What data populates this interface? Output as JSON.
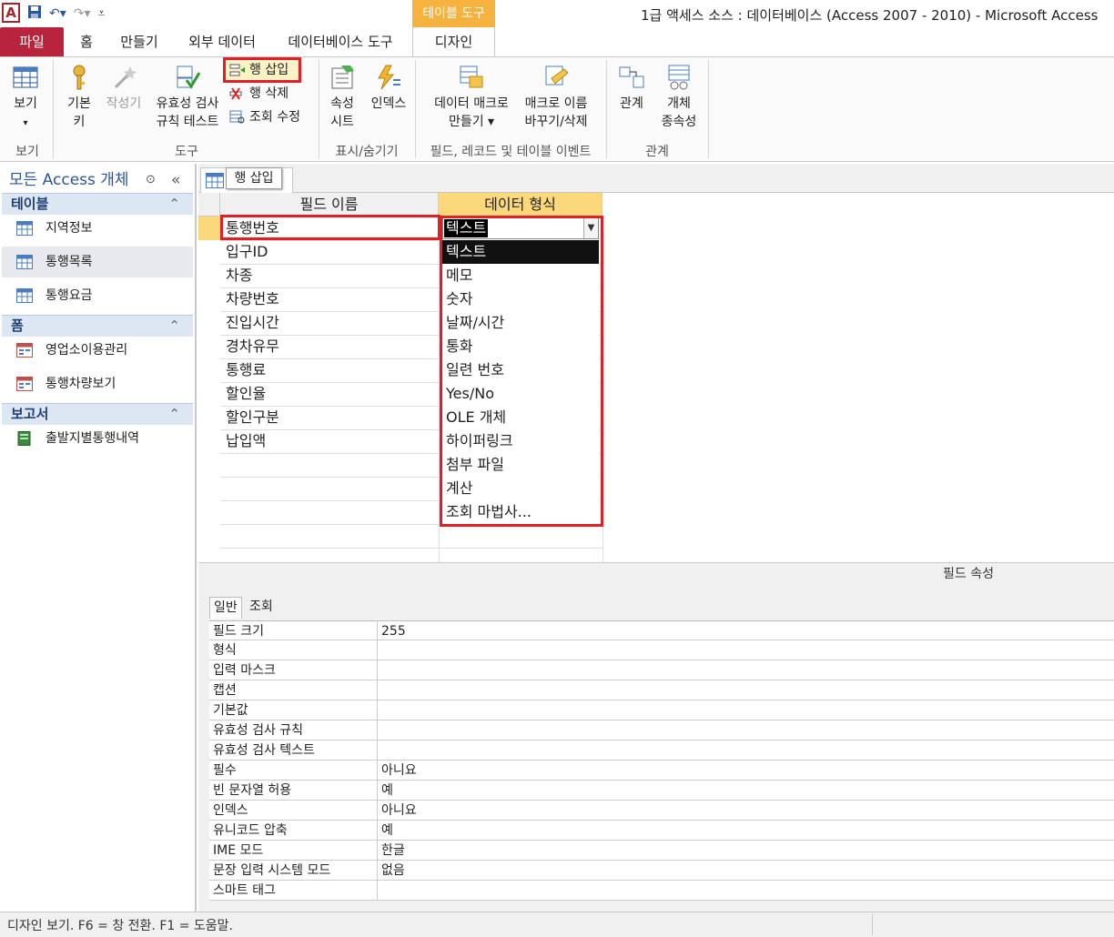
{
  "title": "1급 액세스 소스 : 데이터베이스 (Access 2007 - 2010)  -  Microsoft Access",
  "app_icon_letter": "A",
  "context_tab": "테이블 도구",
  "tabs": [
    "파일",
    "홈",
    "만들기",
    "외부 데이터",
    "데이터베이스 도구",
    "디자인"
  ],
  "ribbon": {
    "view": {
      "label": "보기",
      "sub": "▾",
      "group": "보기"
    },
    "primary_key": {
      "label1": "기본",
      "label2": "키"
    },
    "builder": {
      "label": "작성기"
    },
    "test_validation": {
      "label1": "유효성 검사",
      "label2": "규칙 테스트"
    },
    "insert_row": "행 삽입",
    "delete_row": "행 삭제",
    "modify_lookups": "조회 수정",
    "tools_group": "도구",
    "property_sheet": {
      "label1": "속성",
      "label2": "시트"
    },
    "indexes": {
      "label": "인덱스"
    },
    "showhide_group": "표시/숨기기",
    "data_macros": {
      "label1": "데이터 매크로",
      "label2": "만들기 ▾"
    },
    "rename_macro": {
      "label1": "매크로 이름",
      "label2": "바꾸기/삭제"
    },
    "events_group": "필드, 레코드 및 테이블 이벤트",
    "relationships": {
      "label": "관계"
    },
    "dependencies": {
      "label1": "개체",
      "label2": "종속성"
    },
    "rel_group": "관계"
  },
  "nav": {
    "header": "모든 Access 개체",
    "sections": [
      {
        "title": "테이블",
        "items": [
          "지역정보",
          "통행목록",
          "통행요금"
        ]
      },
      {
        "title": "폼",
        "items": [
          "영업소이용관리",
          "통행차량보기"
        ]
      },
      {
        "title": "보고서",
        "items": [
          "출발지별통행내역"
        ]
      }
    ]
  },
  "doc_tab_tooltip": "행 삽입",
  "grid": {
    "col_field": "필드 이름",
    "col_type": "데이터 형식",
    "fields": [
      "통행번호",
      "입구ID",
      "차종",
      "차량번호",
      "진입시간",
      "경차유무",
      "통행료",
      "할인율",
      "할인구분",
      "납입액"
    ],
    "current_type": "텍스트"
  },
  "dropdown_options": [
    "텍스트",
    "메모",
    "숫자",
    "날짜/시간",
    "통화",
    "일련 번호",
    "Yes/No",
    "OLE 개체",
    "하이퍼링크",
    "첨부 파일",
    "계산",
    "조회 마법사..."
  ],
  "props": {
    "title": "필드 속성",
    "tab_general": "일반",
    "tab_lookup": "조회",
    "rows": [
      {
        "k": "필드 크기",
        "v": "255"
      },
      {
        "k": "형식",
        "v": ""
      },
      {
        "k": "입력 마스크",
        "v": ""
      },
      {
        "k": "캡션",
        "v": ""
      },
      {
        "k": "기본값",
        "v": ""
      },
      {
        "k": "유효성 검사 규칙",
        "v": ""
      },
      {
        "k": "유효성 검사 텍스트",
        "v": ""
      },
      {
        "k": "필수",
        "v": "아니요"
      },
      {
        "k": "빈 문자열 허용",
        "v": "예"
      },
      {
        "k": "인덱스",
        "v": "아니요"
      },
      {
        "k": "유니코드 압축",
        "v": "예"
      },
      {
        "k": "IME 모드",
        "v": "한글"
      },
      {
        "k": "문장 입력 시스템 모드",
        "v": "없음"
      },
      {
        "k": "스마트 태그",
        "v": ""
      }
    ]
  },
  "status": "디자인 보기.  F6 = 창 전환.  F1 = 도움말.",
  "colors": {
    "file_tab": "#b8243b",
    "context": "#f6b23e",
    "highlight": "#e21f26"
  }
}
